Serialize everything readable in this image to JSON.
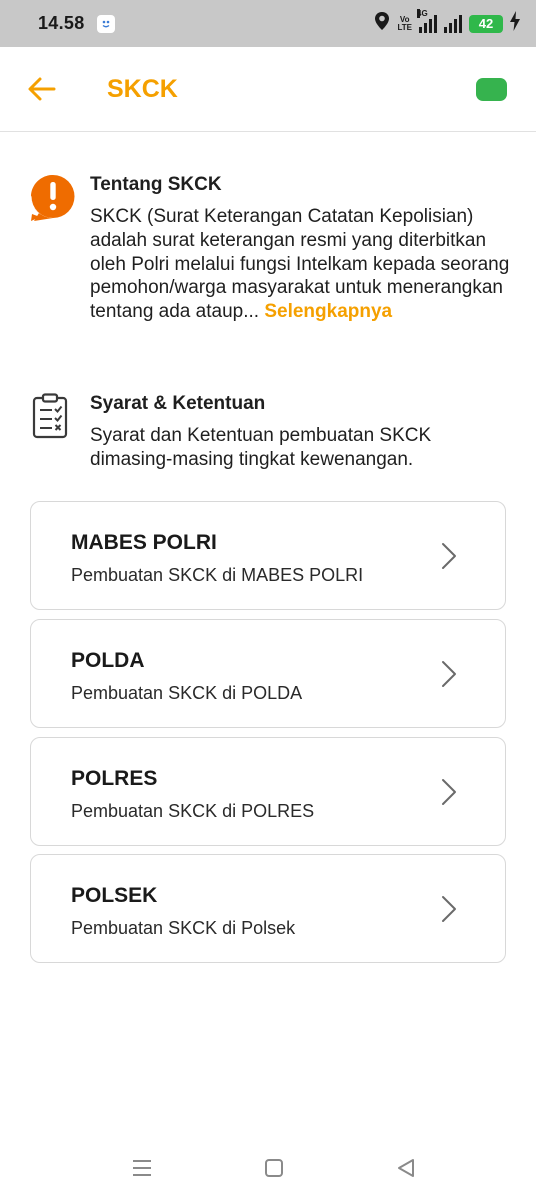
{
  "status_bar": {
    "time": "14.58",
    "volte_top": "Vo",
    "volte_bottom": "LTE",
    "network": "4G",
    "battery": "42"
  },
  "app_bar": {
    "title": "SKCK",
    "accent_color": "#f5a000"
  },
  "about": {
    "title": "Tentang SKCK",
    "text": "SKCK (Surat Keterangan Catatan Kepolisian) adalah surat keterangan resmi yang diterbitkan oleh Polri melalui fungsi Intelkam kepada seorang pemohon/warga masyarakat untuk menerangkan tentang ada ataup...",
    "more_label": "Selengkapnya"
  },
  "terms": {
    "title": "Syarat & Ketentuan",
    "text": "Syarat dan Ketentuan pembuatan SKCK dimasing-masing tingkat kewenangan."
  },
  "options": [
    {
      "title": "MABES POLRI",
      "subtitle": "Pembuatan SKCK di MABES POLRI"
    },
    {
      "title": "POLDA",
      "subtitle": "Pembuatan SKCK di POLDA"
    },
    {
      "title": "POLRES",
      "subtitle": "Pembuatan SKCK di POLRES"
    },
    {
      "title": "POLSEK",
      "subtitle": "Pembuatan SKCK di Polsek"
    }
  ],
  "icons": {
    "back": "arrow-left-icon",
    "about": "exclamation-bubble-icon",
    "terms": "clipboard-checklist-icon",
    "card": "chevron-right-icon",
    "nav_recent": "menu-lines-icon",
    "nav_home": "square-icon",
    "nav_back": "triangle-back-icon"
  }
}
